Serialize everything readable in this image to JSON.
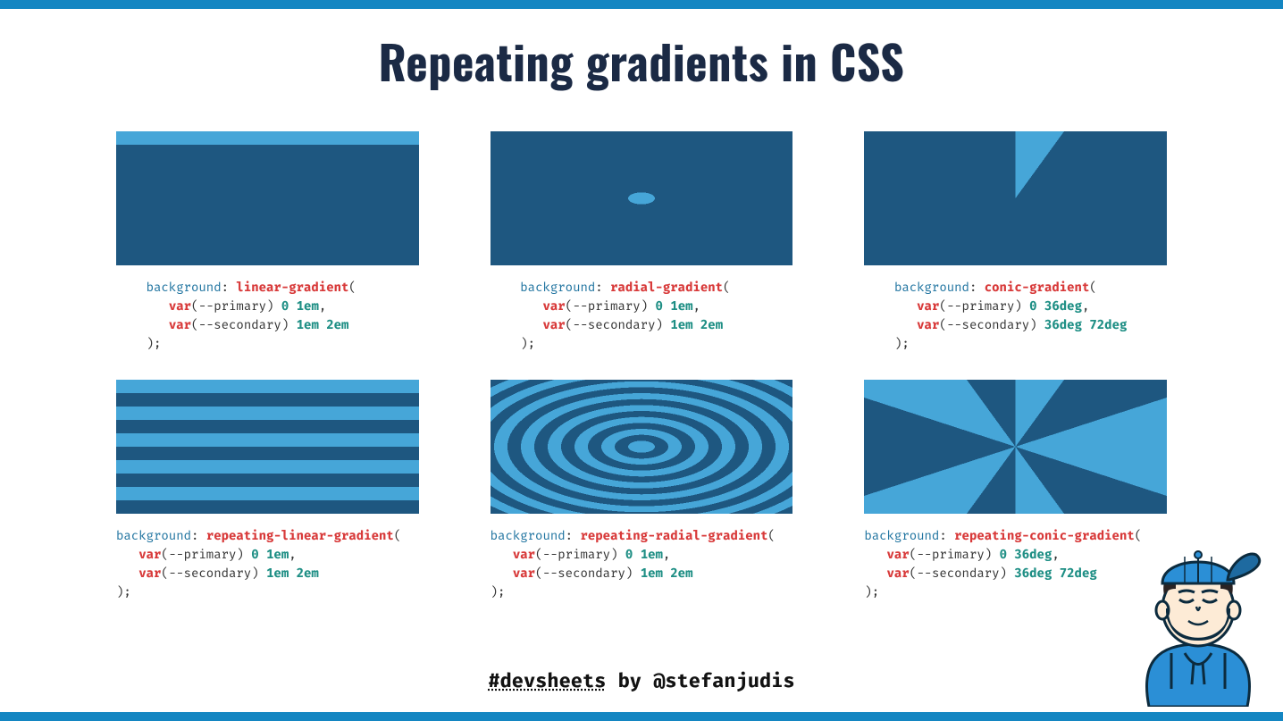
{
  "title": "Repeating gradients in CSS",
  "footer": {
    "hash": "#devsheets",
    "by": " by ",
    "handle": "@stefanjudis"
  },
  "cells": [
    {
      "prop": "background",
      "fn": "linear-gradient",
      "indent_base": "    ",
      "indent_arg": "       ",
      "line1_var": "var",
      "line1_name": "--primary",
      "line1_nums": "0 1em",
      "line2_var": "var",
      "line2_name": "--secondary",
      "line2_nums": "1em 2em"
    },
    {
      "prop": "background",
      "fn": "radial-gradient",
      "indent_base": "    ",
      "indent_arg": "       ",
      "line1_var": "var",
      "line1_name": "--primary",
      "line1_nums": "0 1em",
      "line2_var": "var",
      "line2_name": "--secondary",
      "line2_nums": "1em 2em"
    },
    {
      "prop": "background",
      "fn": "conic-gradient",
      "indent_base": "    ",
      "indent_arg": "       ",
      "line1_var": "var",
      "line1_name": "--primary",
      "line1_nums": "0 36deg",
      "line2_var": "var",
      "line2_name": "--secondary",
      "line2_nums": "36deg 72deg"
    },
    {
      "prop": "background",
      "fn": "repeating-linear-gradient",
      "indent_base": "",
      "indent_arg": "   ",
      "line1_var": "var",
      "line1_name": "--primary",
      "line1_nums": "0 1em",
      "line2_var": "var",
      "line2_name": "--secondary",
      "line2_nums": "1em 2em"
    },
    {
      "prop": "background",
      "fn": "repeating-radial-gradient",
      "indent_base": "",
      "indent_arg": "   ",
      "line1_var": "var",
      "line1_name": "--primary",
      "line1_nums": "0 1em",
      "line2_var": "var",
      "line2_name": "--secondary",
      "line2_nums": "1em 2em"
    },
    {
      "prop": "background",
      "fn": "repeating-conic-gradient",
      "indent_base": "",
      "indent_arg": "   ",
      "line1_var": "var",
      "line1_name": "--primary",
      "line1_nums": "0 36deg",
      "line2_var": "var",
      "line2_name": "--secondary",
      "line2_nums": "36deg 72deg"
    }
  ]
}
